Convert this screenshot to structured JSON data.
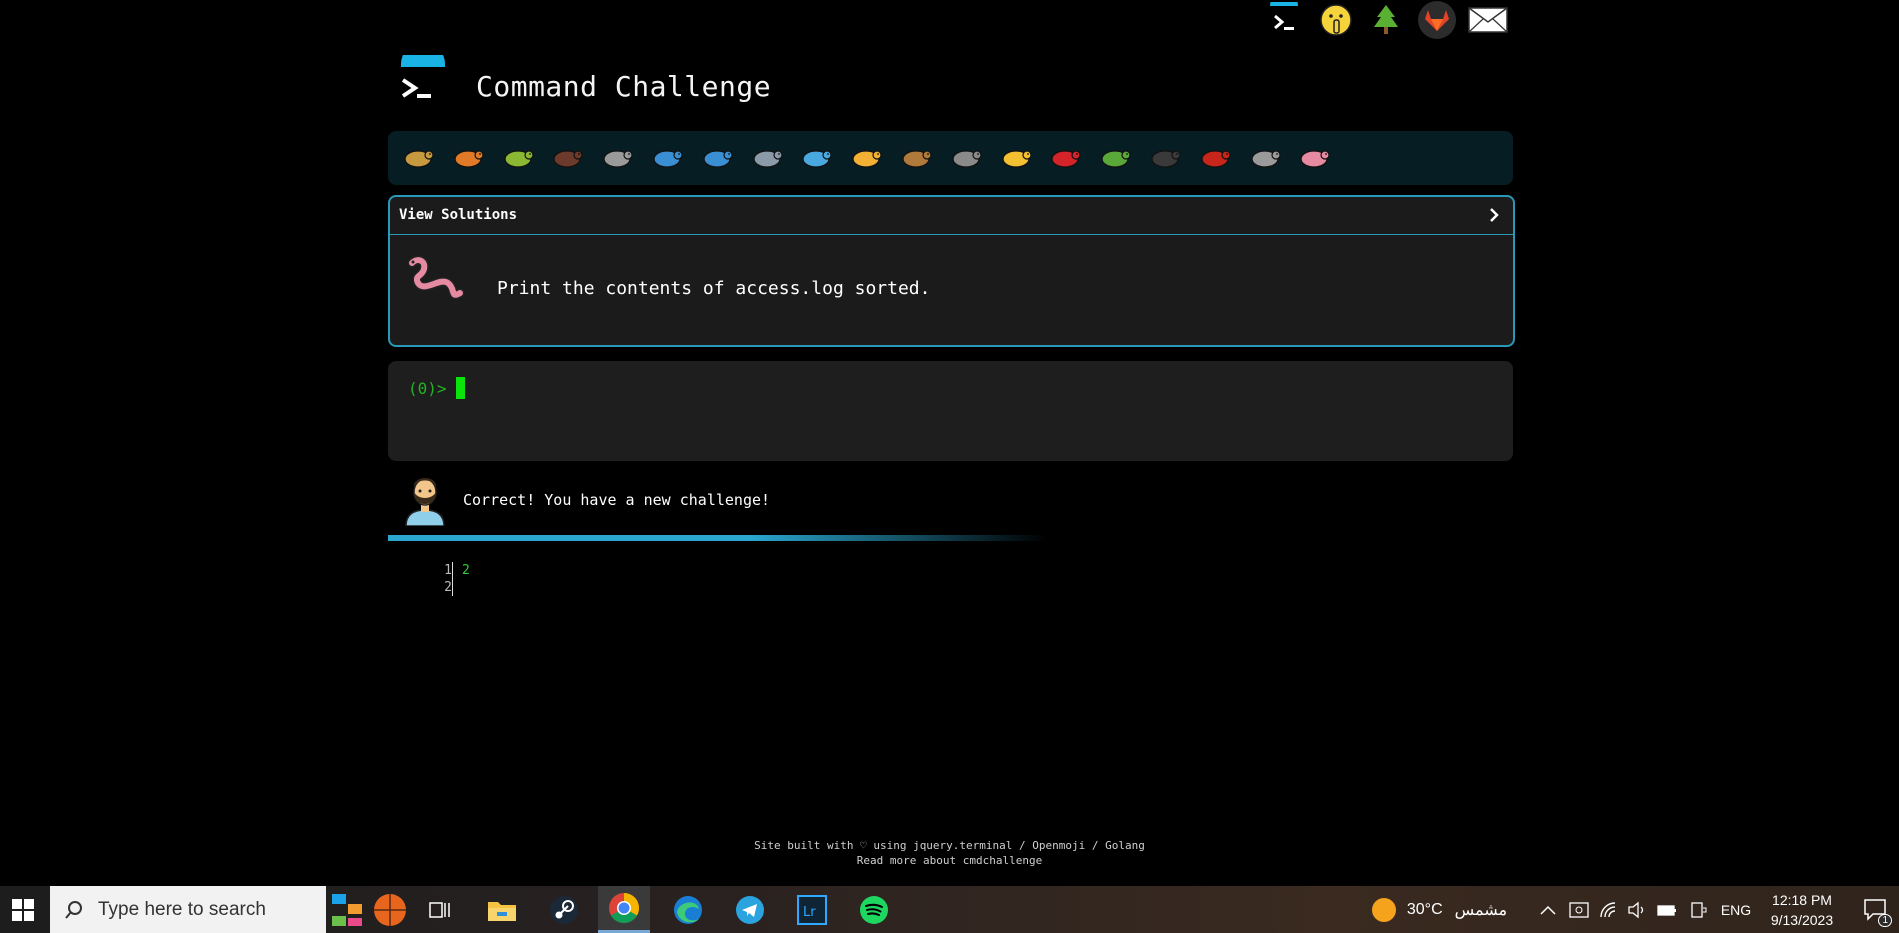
{
  "header": {
    "title": "Command Challenge",
    "logo_icon": "terminal-logo-icon"
  },
  "top_links": [
    {
      "icon": "terminal-icon"
    },
    {
      "icon": "shushing-face-icon"
    },
    {
      "icon": "tree-icon"
    },
    {
      "icon": "gitlab-icon"
    },
    {
      "icon": "mail-icon"
    }
  ],
  "challenges": [
    {
      "icon": "snail-icon",
      "color": "#c79a3f"
    },
    {
      "icon": "butterfly-icon",
      "color": "#e07a26"
    },
    {
      "icon": "caterpillar-icon",
      "color": "#8ab832"
    },
    {
      "icon": "ant-icon",
      "color": "#6b3a2a"
    },
    {
      "icon": "spider-web-icon",
      "color": "#9a9a9a"
    },
    {
      "icon": "whale-icon",
      "color": "#3a8fd4"
    },
    {
      "icon": "dolphin-icon",
      "color": "#3a8fd4"
    },
    {
      "icon": "shark-icon",
      "color": "#8a9aa8"
    },
    {
      "icon": "fish-icon",
      "color": "#4aa8e0"
    },
    {
      "icon": "tropical-fish-icon",
      "color": "#f2b134"
    },
    {
      "icon": "blowfish-icon",
      "color": "#b07a3a"
    },
    {
      "icon": "wolf-icon",
      "color": "#8a8a8a"
    },
    {
      "icon": "bee-icon",
      "color": "#f2c030"
    },
    {
      "icon": "ladybug-icon",
      "color": "#d4242a"
    },
    {
      "icon": "cricket-icon",
      "color": "#5aa83a"
    },
    {
      "icon": "spider-icon",
      "color": "#3a3a3a"
    },
    {
      "icon": "scorpion-icon",
      "color": "#c8261a"
    },
    {
      "icon": "fly-icon",
      "color": "#9a9a9a"
    },
    {
      "icon": "worm-icon",
      "color": "#e58aa0"
    }
  ],
  "panel": {
    "header_label": "View Solutions",
    "task_icon": "worm-icon",
    "task_text": "Print the contents of access.log sorted."
  },
  "terminal": {
    "prompt": "(0)>"
  },
  "feedback": {
    "avatar_icon": "bearded-man-icon",
    "message": "Correct! You have a new challenge!",
    "progress": 0.55
  },
  "output": {
    "line_numbers": [
      "1",
      "2"
    ],
    "lines": [
      "2",
      ""
    ]
  },
  "footer": {
    "line1": "Site built with ♡ using jquery.terminal / Openmoji / Golang",
    "line2": "Read more about cmdchallenge"
  },
  "taskbar": {
    "search_placeholder": "Type here to search",
    "apps": [
      "task-view-icon",
      "file-explorer-icon",
      "steam-icon",
      "chrome-icon",
      "edge-icon",
      "telegram-icon",
      "lightroom-icon",
      "spotify-icon"
    ],
    "weather_temp": "30°C",
    "weather_desc": "مشمس",
    "language": "ENG",
    "time": "12:18 PM",
    "date": "9/13/2023",
    "notification_count": "1"
  }
}
